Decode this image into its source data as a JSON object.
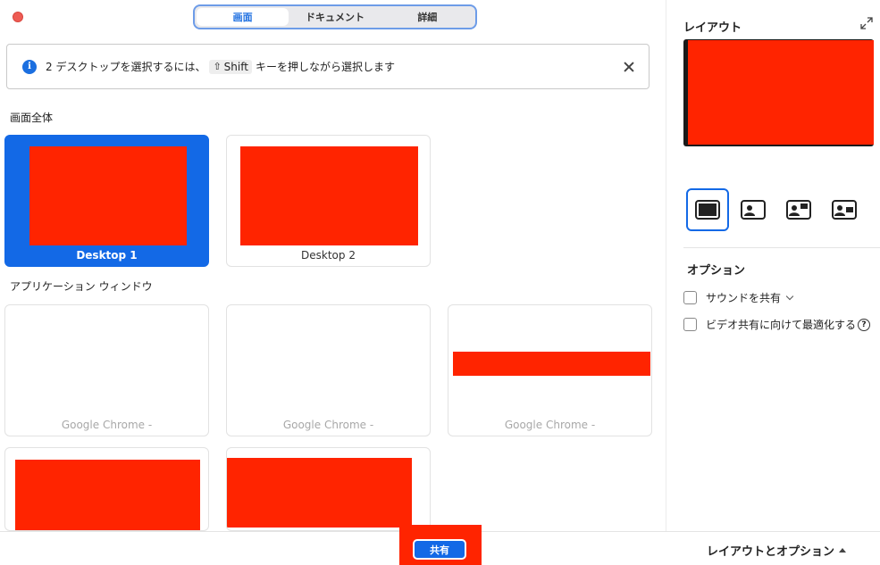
{
  "tabs": [
    {
      "label": "画面",
      "active": true
    },
    {
      "label": "ドキュメント",
      "active": false
    },
    {
      "label": "詳細",
      "active": false
    }
  ],
  "banner": {
    "info_icon": "i",
    "text_before": "2 デスクトップを選択するには、",
    "key_symbol": "⇧",
    "key_label": "Shift",
    "text_after": "キーを押しながら選択します"
  },
  "sections": {
    "fullscreen": "画面全体",
    "apps": "アプリケーション ウィンドウ"
  },
  "desktops": [
    {
      "label": "Desktop 1",
      "selected": true
    },
    {
      "label": "Desktop 2",
      "selected": false
    }
  ],
  "app_windows": [
    {
      "label": "Google Chrome -"
    },
    {
      "label": "Google Chrome -"
    },
    {
      "label": "Google Chrome -"
    }
  ],
  "bottom": {
    "share_label": "共有",
    "layout_options_label": "レイアウトとオプション"
  },
  "panel": {
    "title": "レイアウト",
    "options_title": "オプション",
    "option_sound": "サウンドを共有",
    "option_video": "ビデオ共有に向けて最適化する",
    "help_glyph": "?"
  },
  "colors": {
    "accent": "#1369e6",
    "redaction": "#ff2400"
  }
}
